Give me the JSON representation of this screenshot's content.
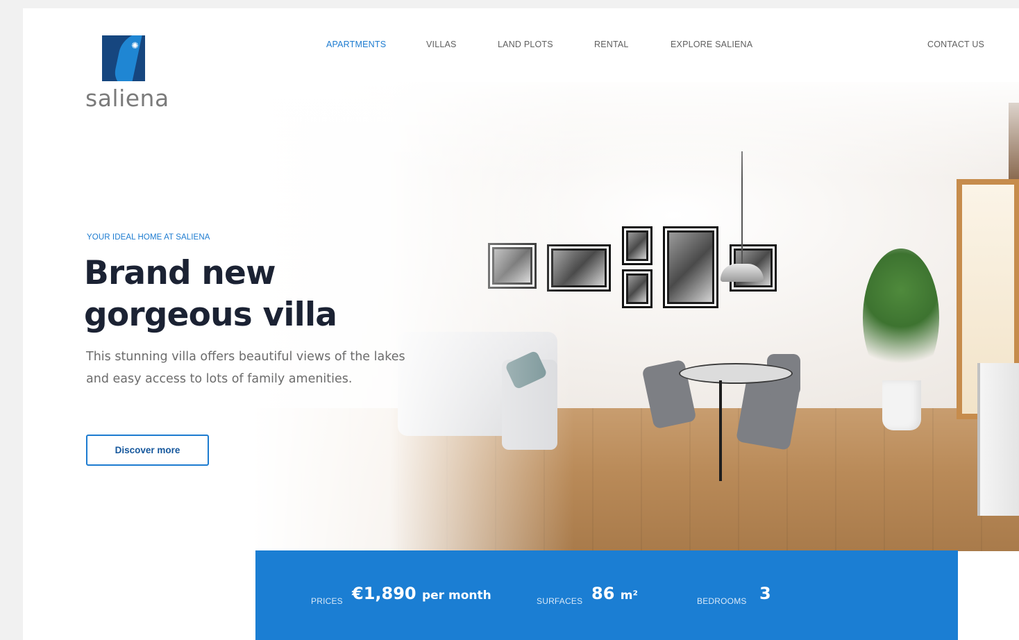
{
  "brand": {
    "name": "saliena",
    "logo_icon": "sun-icon"
  },
  "nav": {
    "items": [
      {
        "label": "APARTMENTS",
        "active": true
      },
      {
        "label": "VILLAS",
        "active": false
      },
      {
        "label": "LAND PLOTS",
        "active": false
      },
      {
        "label": "RENTAL",
        "active": false
      },
      {
        "label": "EXPLORE SALIENA",
        "active": false
      }
    ],
    "contact": "CONTACT US"
  },
  "hero": {
    "eyebrow": "YOUR IDEAL HOME AT SALIENA",
    "headline": "Brand new gorgeous villa",
    "description": "This stunning villa offers beautiful views of the lakes and easy access to lots of family amenities.",
    "cta": "Discover more"
  },
  "stats": {
    "prices_label": "PRICES",
    "prices_value": "€1,890",
    "prices_unit": "per month",
    "surfaces_label": "SURFACES",
    "surfaces_value": "86",
    "surfaces_unit": "m²",
    "bedrooms_label": "BEDROOMS",
    "bedrooms_value": "3"
  },
  "colors": {
    "accent": "#1c7bd0",
    "stats_bar": "#1b7ed3",
    "logo_dark": "#16467f",
    "heading": "#1b2233"
  }
}
